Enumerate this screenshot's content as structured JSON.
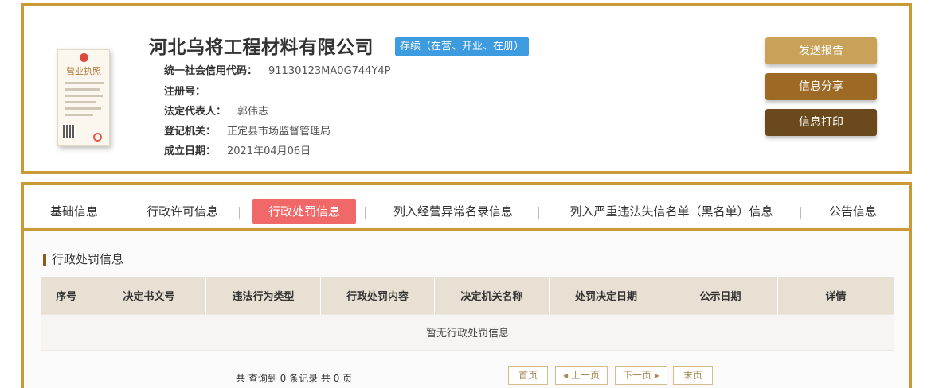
{
  "company": {
    "name": "河北乌将工程材料有限公司",
    "status": "存续（在营、开业、在册）",
    "license_title": "营业执照",
    "fields": [
      {
        "label": "统一社会信用代码：",
        "value": "91130123MA0G744Y4P"
      },
      {
        "label": "注册号：",
        "value": ""
      },
      {
        "label": "法定代表人：",
        "value": "郭伟志"
      },
      {
        "label": "登记机关：",
        "value": "正定县市场监督管理局"
      },
      {
        "label": "成立日期：",
        "value": "2021年04月06日"
      }
    ]
  },
  "actions": {
    "report": "发送报告",
    "share": "信息分享",
    "print": "信息打印"
  },
  "tabs": [
    {
      "label": "基础信息",
      "active": false
    },
    {
      "label": "行政许可信息",
      "active": false
    },
    {
      "label": "行政处罚信息",
      "active": true
    },
    {
      "label": "列入经营异常名录信息",
      "active": false
    },
    {
      "label": "列入严重违法失信名单（黑名单）信息",
      "active": false
    },
    {
      "label": "公告信息",
      "active": false
    }
  ],
  "section": {
    "title": "行政处罚信息",
    "columns": [
      "序号",
      "决定书文号",
      "违法行为类型",
      "行政处罚内容",
      "决定机关名称",
      "处罚决定日期",
      "公示日期",
      "详情"
    ],
    "empty_text": "暂无行政处罚信息"
  },
  "pager": {
    "summary": "共 查询到 0 条记录 共 0 页",
    "first": "首页",
    "prev": "上一页",
    "next": "下一页",
    "last": "末页"
  },
  "colors": {
    "frame": "#c99a36",
    "status_badge": "#3d9be0",
    "active_tab": "#f06868",
    "header_row": "#e8e0d2"
  }
}
